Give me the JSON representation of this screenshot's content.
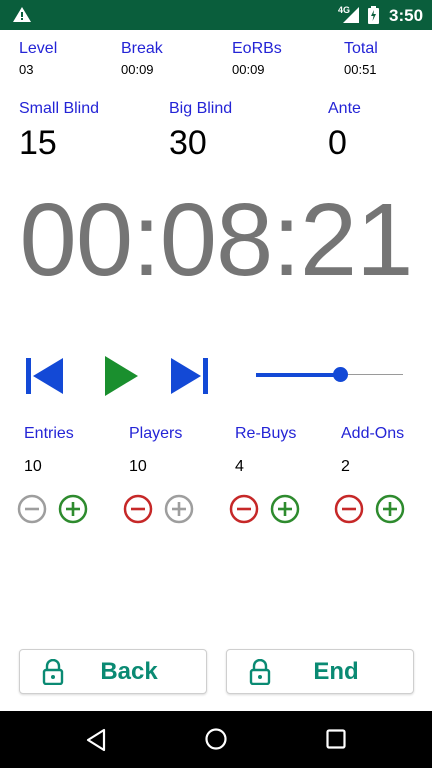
{
  "status_bar": {
    "network": "4G",
    "time": "3:50",
    "icons": [
      "warning-icon",
      "signal-icon",
      "battery-charging-icon"
    ]
  },
  "stats": [
    {
      "label": "Level",
      "value": "03"
    },
    {
      "label": "Break",
      "value": "00:09"
    },
    {
      "label": "EoRBs",
      "value": "00:09"
    },
    {
      "label": "Total",
      "value": "00:51"
    }
  ],
  "blinds": [
    {
      "label": "Small Blind",
      "value": "15"
    },
    {
      "label": "Big Blind",
      "value": "30"
    },
    {
      "label": "Ante",
      "value": "0"
    }
  ],
  "timer": "00:08:21",
  "controls": {
    "icons": [
      "skip-previous-icon",
      "play-icon",
      "skip-next-icon"
    ],
    "slider_level": 0.6
  },
  "counters": [
    {
      "label": "Entries",
      "value": "10"
    },
    {
      "label": "Players",
      "value": "10"
    },
    {
      "label": "Re-Buys",
      "value": "4"
    },
    {
      "label": "Add-Ons",
      "value": "2"
    }
  ],
  "actions": {
    "back_label": "Back",
    "end_label": "End"
  },
  "colors": {
    "status_bar": "#0a5e3c",
    "label_blue": "#2424d6",
    "transport_blue": "#1349d6",
    "play_green": "#1a8f2e",
    "minus_red": "#c62828",
    "plus_green": "#2e8b2e",
    "disabled_grey": "#9e9e9e",
    "button_text_teal": "#0a8a73"
  }
}
